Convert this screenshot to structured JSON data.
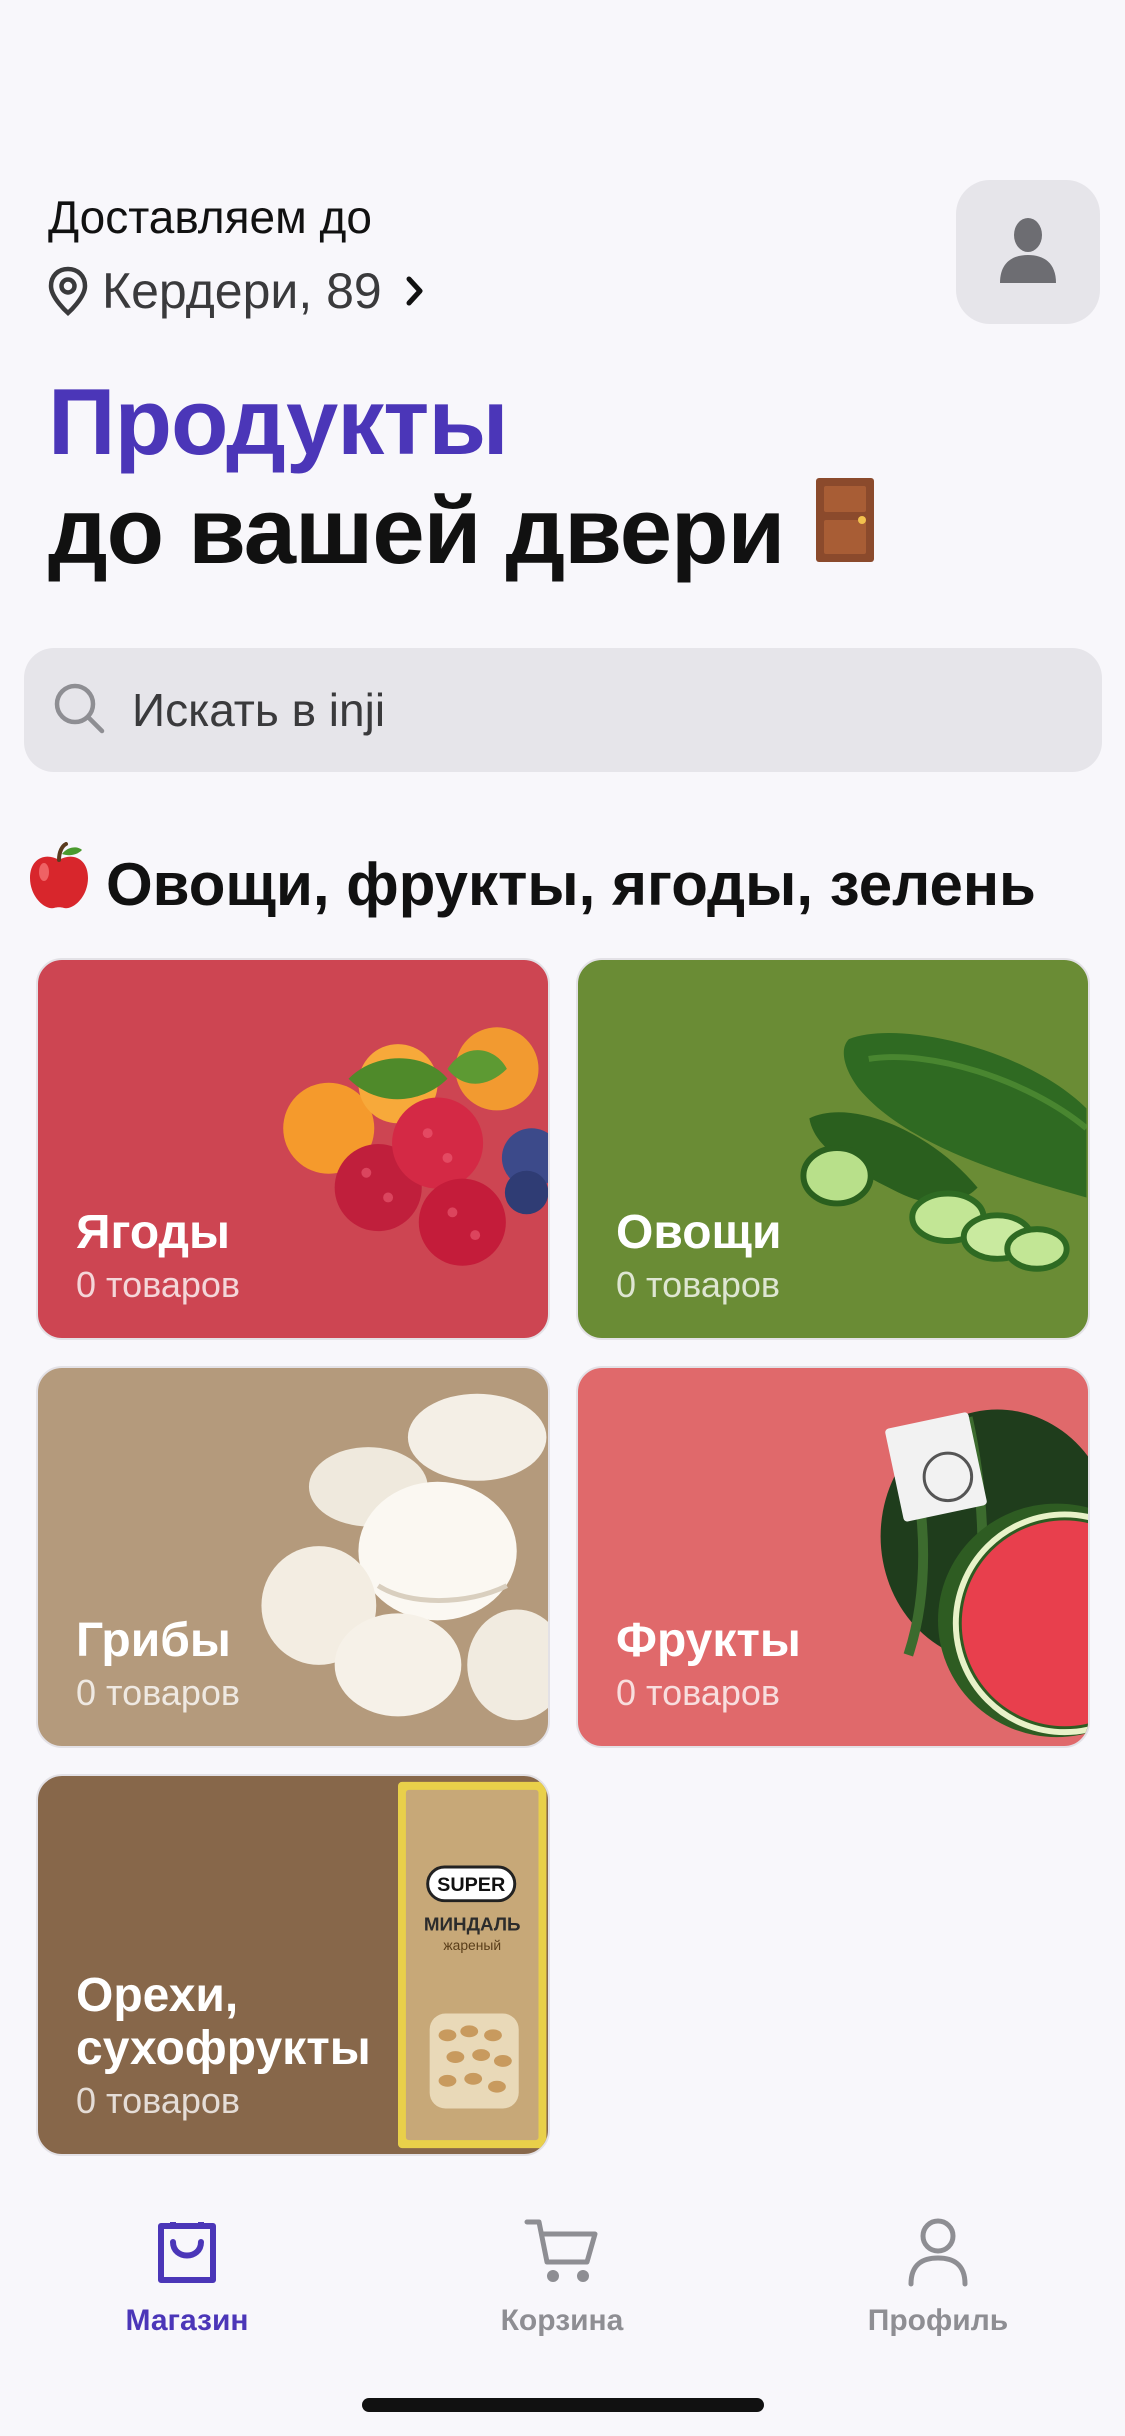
{
  "header": {
    "deliver_label": "Доставляем до",
    "address": "Кердери, 89"
  },
  "title": {
    "line1": "Продукты",
    "line2": "до вашей двери"
  },
  "search": {
    "placeholder": "Искать в inji"
  },
  "section": {
    "title": "Овощи, фрукты, ягоды, зелень"
  },
  "categories": [
    {
      "name": "Ягоды",
      "count": "0 товаров",
      "color": "#cd4552"
    },
    {
      "name": "Овощи",
      "count": "0 товаров",
      "color": "#6a8c35"
    },
    {
      "name": "Грибы",
      "count": "0 товаров",
      "color": "#b49a7c"
    },
    {
      "name": "Фрукты",
      "count": "0 товаров",
      "color": "#e0696b"
    },
    {
      "name": "Орехи,\nсухофрукты",
      "count": "0 товаров",
      "color": "#87674a"
    }
  ],
  "tabs": [
    {
      "label": "Магазин",
      "icon": "bag-icon",
      "active": true
    },
    {
      "label": "Корзина",
      "icon": "cart-icon",
      "active": false
    },
    {
      "label": "Профиль",
      "icon": "person-icon",
      "active": false
    }
  ],
  "colors": {
    "accent": "#4b36b8",
    "inactive": "#8e8e93"
  },
  "product_image": {
    "pack_brand": "SUPER",
    "pack_title": "МИНДАЛЬ",
    "pack_subtitle": "жареный"
  }
}
